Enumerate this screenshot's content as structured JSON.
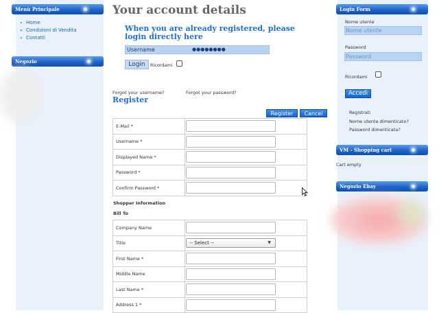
{
  "left_sidebar": {
    "main_menu_title": "Menù Principale",
    "menu_items": [
      {
        "label": "Home"
      },
      {
        "label": "Condizioni di Vendita"
      },
      {
        "label": "Contatti"
      }
    ],
    "shop_title": "Negozio"
  },
  "main": {
    "page_title": "Your account details",
    "login_heading": "When you are already registered, please login directly here",
    "username_label": "Username",
    "password_mask": "●●●●●●●●",
    "login_button": "Login",
    "remember_label": "Ricordami",
    "forgot_username": "Forgot your username?",
    "forgot_password": "Forgot your password?",
    "register_heading": "Register",
    "register_button": "Register",
    "cancel_button": "Cancel",
    "account_fields": [
      {
        "label": "E-Mail *"
      },
      {
        "label": "Username *"
      },
      {
        "label": "Displayed Name *"
      },
      {
        "label": "Password *"
      },
      {
        "label": "Confirm Password *"
      }
    ],
    "shopper_info_label": "Shopper Information",
    "bill_to_label": "Bill To",
    "bill_fields": [
      {
        "label": "Company Name",
        "type": "text"
      },
      {
        "label": "Title",
        "type": "select",
        "value": "-- Select --"
      },
      {
        "label": "First Name *",
        "type": "text"
      },
      {
        "label": "Middle Name",
        "type": "text"
      },
      {
        "label": "Last Name *",
        "type": "text"
      },
      {
        "label": "Address 1 *",
        "type": "text"
      }
    ]
  },
  "right_sidebar": {
    "login_title": "Login Form",
    "username_label": "Nome utente",
    "username_placeholder": "Nome utente",
    "password_label": "Password",
    "password_placeholder": "Password",
    "remember_label": "Ricordami",
    "submit_button": "Accedi",
    "links": [
      {
        "label": "Registrati"
      },
      {
        "label": "Nome utente dimenticato?"
      },
      {
        "label": "Password dimenticata?"
      }
    ],
    "cart_title": "VM - Shopping cart",
    "cart_status": "Cart empty",
    "ebay_title": "Negozio Ebay"
  }
}
